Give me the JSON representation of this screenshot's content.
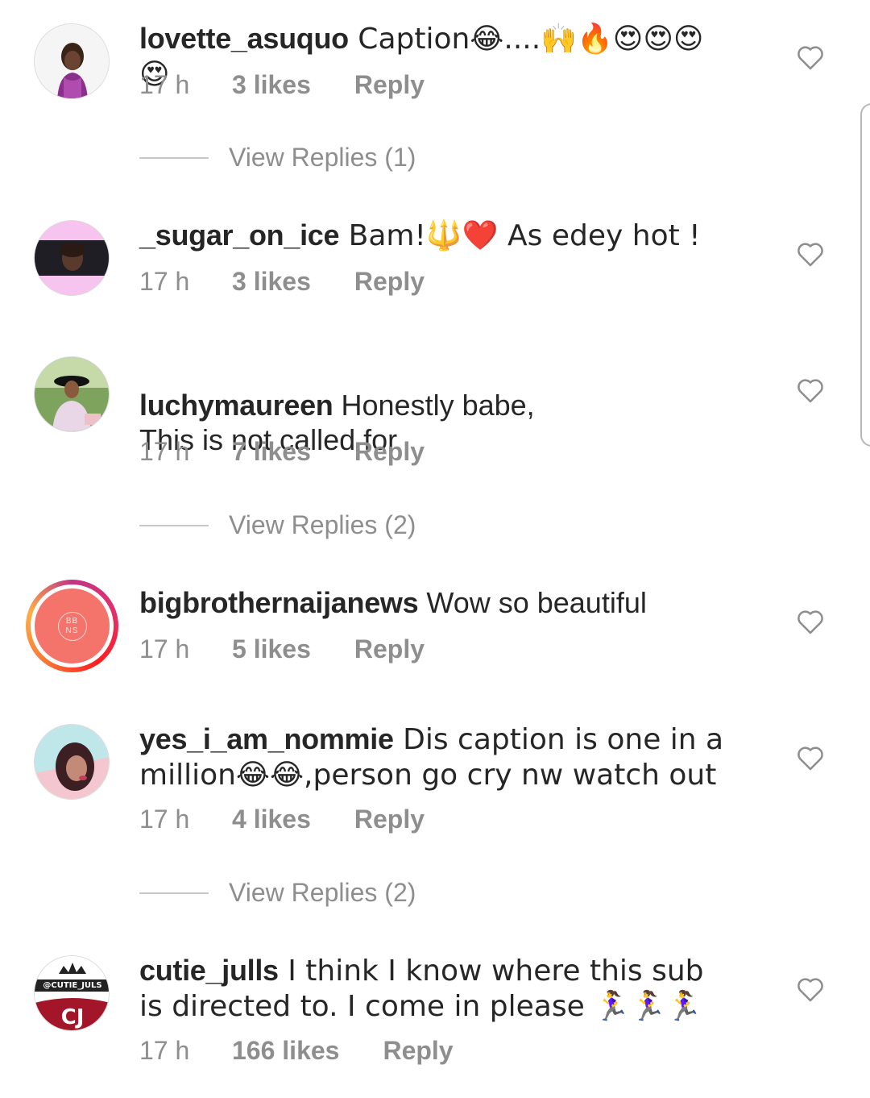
{
  "comments": [
    {
      "username": "lovette_asuquo",
      "text": " Caption😂....🙌🔥😍😍😍😍",
      "time": "17 h",
      "likes": "3 likes",
      "reply": "Reply",
      "avatar_icon": "profile-photo-woman-purple",
      "view_replies": "View Replies (1)"
    },
    {
      "username": "_sugar_on_ice",
      "text": " Bam!🔱❤️ As edey hot !",
      "time": "17 h",
      "likes": "3 likes",
      "reply": "Reply",
      "avatar_icon": "profile-photo-pink-banner"
    },
    {
      "username": "luchymaureen",
      "text": " Honestly babe,\nThis is not called for",
      "time": "17 h",
      "likes": "7 likes",
      "reply": "Reply",
      "avatar_icon": "profile-photo-woman-hat-outdoors",
      "view_replies": "View Replies (2)"
    },
    {
      "username": "bigbrothernaijanews",
      "text": " Wow so beautiful",
      "time": "17 h",
      "likes": "5 likes",
      "reply": "Reply",
      "avatar_icon": "bbns-logo",
      "avatar_logo": "BB NS"
    },
    {
      "username": "yes_i_am_nommie",
      "text": " Dis caption is one in a million😂😂,person go cry nw watch out",
      "time": "17 h",
      "likes": "4 likes",
      "reply": "Reply",
      "avatar_icon": "profile-photo-woman-pink",
      "view_replies": "View Replies (2)"
    },
    {
      "username": "cutie_julls",
      "text": " I think I know where this sub is directed to. I come in please 🏃‍♀️🏃‍♀️🏃‍♀️",
      "time": "17 h",
      "likes": "166 likes",
      "reply": "Reply",
      "avatar_icon": "cutie-juls-logo",
      "avatar_logo": "@CUTIE_JULS"
    }
  ],
  "icons": {
    "like": "heart-outline-icon"
  },
  "colors": {
    "primary_text": "#262626",
    "secondary_text": "#8e8e8e",
    "divider": "#c7c7c7",
    "story_ring": "#e1306c",
    "bbns_avatar": "#f4736b",
    "cutie_avatar": "#a3162a"
  }
}
